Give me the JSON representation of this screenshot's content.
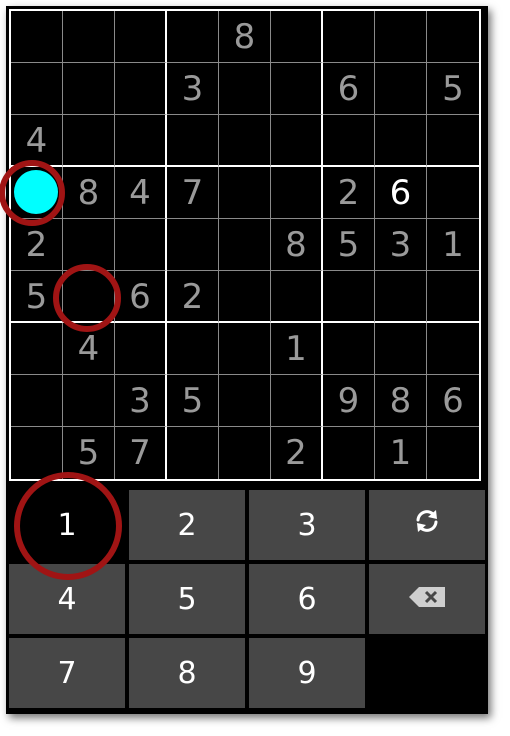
{
  "board": {
    "cells": [
      [
        "",
        "",
        "",
        "",
        "8",
        "",
        "",
        "",
        ""
      ],
      [
        "",
        "",
        "",
        "3",
        "",
        "",
        "6",
        "",
        "5"
      ],
      [
        "4",
        "",
        "",
        "",
        "",
        "",
        "",
        "",
        ""
      ],
      [
        "",
        "8",
        "4",
        "7",
        "",
        "",
        "2",
        "6",
        ""
      ],
      [
        "2",
        "",
        "",
        "",
        "",
        "8",
        "5",
        "3",
        "1"
      ],
      [
        "5",
        "",
        "6",
        "2",
        "",
        "",
        "",
        "",
        ""
      ],
      [
        "",
        "4",
        "",
        "",
        "",
        "1",
        "",
        "",
        ""
      ],
      [
        "",
        "",
        "3",
        "5",
        "",
        "",
        "9",
        "8",
        "6"
      ],
      [
        "",
        "5",
        "7",
        "",
        "",
        "2",
        "",
        "1",
        ""
      ]
    ],
    "user_entries": [
      [
        3,
        7
      ]
    ],
    "selected": [
      3,
      0
    ],
    "colors": {
      "given": "#9a9a9a",
      "user": "#ffffff",
      "selection": "#00ffff",
      "highlight": "#a01414"
    }
  },
  "keypad": {
    "keys": [
      {
        "label": "1",
        "name": "key-1",
        "active": true
      },
      {
        "label": "2",
        "name": "key-2"
      },
      {
        "label": "3",
        "name": "key-3"
      },
      {
        "label": "",
        "name": "refresh-button",
        "icon": "refresh-icon"
      },
      {
        "label": "4",
        "name": "key-4"
      },
      {
        "label": "5",
        "name": "key-5"
      },
      {
        "label": "6",
        "name": "key-6"
      },
      {
        "label": "",
        "name": "backspace-button",
        "icon": "backspace-icon"
      },
      {
        "label": "7",
        "name": "key-7"
      },
      {
        "label": "8",
        "name": "key-8"
      },
      {
        "label": "9",
        "name": "key-9"
      },
      {
        "label": "",
        "name": "empty-slot",
        "empty": true
      }
    ]
  }
}
